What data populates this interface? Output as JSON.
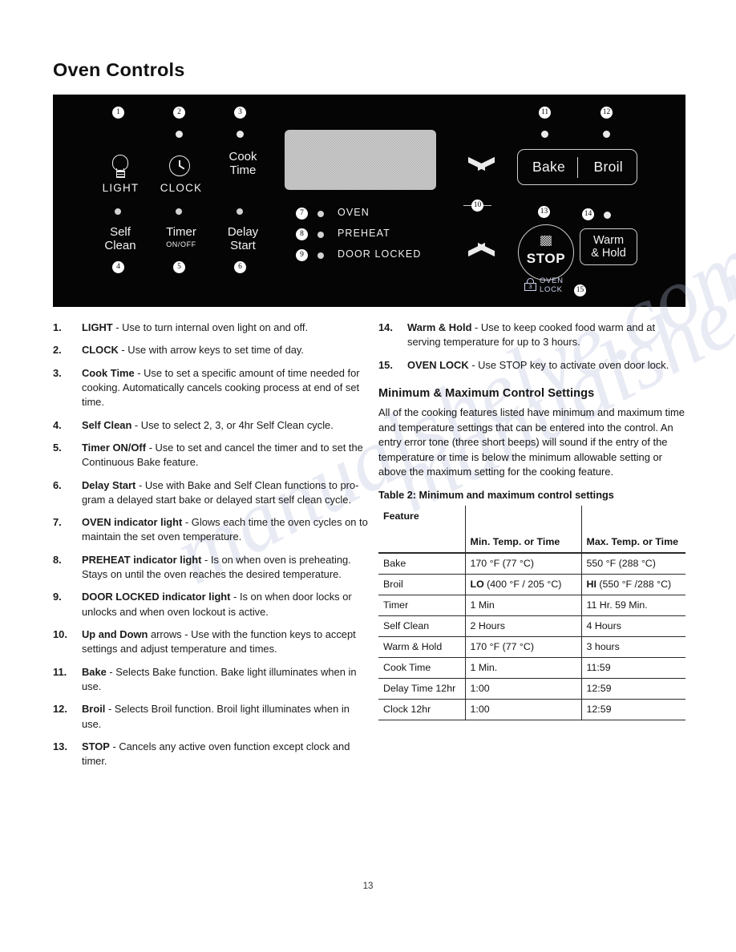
{
  "page": {
    "title": "Oven Controls",
    "page_number": "13",
    "watermark": "manualshelve.com"
  },
  "panel": {
    "display_label": "display-window",
    "keys": [
      {
        "callout": "1",
        "label": "LIGHT",
        "icon": "light-bulb-icon"
      },
      {
        "callout": "2",
        "label": "CLOCK",
        "icon": "clock-icon"
      },
      {
        "callout": "3",
        "label_line1": "Cook",
        "label_line2": "Time"
      },
      {
        "callout": "4",
        "label_line1": "Self",
        "label_line2": "Clean"
      },
      {
        "callout": "5",
        "label_line1": "Timer",
        "sub": "ON/OFF"
      },
      {
        "callout": "6",
        "label_line1": "Delay",
        "label_line2": "Start"
      }
    ],
    "indicators": [
      {
        "callout": "7",
        "label": "OVEN"
      },
      {
        "callout": "8",
        "label": "PREHEAT"
      },
      {
        "callout": "9",
        "label": "DOOR LOCKED"
      }
    ],
    "arrows": {
      "callout": "10",
      "up": "up-arrow",
      "down": "down-arrow"
    },
    "bake_broil": {
      "bake_callout": "11",
      "broil_callout": "12",
      "bake_label": "Bake",
      "broil_label": "Broil"
    },
    "stop": {
      "callout": "13",
      "label": "STOP"
    },
    "warm_hold": {
      "callout": "14",
      "line1": "Warm",
      "line2": "& Hold"
    },
    "oven_lock": {
      "callout": "15",
      "line1": "OVEN",
      "line2": "LOCK",
      "lock_digit": "3"
    }
  },
  "left_list": [
    {
      "num": "1.",
      "term": "LIGHT",
      "rest": " - Use to turn internal oven light on and off."
    },
    {
      "num": "2.",
      "term": "CLOCK",
      "rest": " - Use with arrow keys to set time of day."
    },
    {
      "num": "3.",
      "term": "Cook Time",
      "rest": " - Use to set a specific amount of time needed for cooking. Automatically cancels cooking process at end of set time."
    },
    {
      "num": "4.",
      "term": "Self Clean",
      "rest": " - Use to select 2, 3, or 4hr Self Clean cycle."
    },
    {
      "num": "5.",
      "term": "Timer ON/Off",
      "rest": " - Use to set and cancel the timer and to set the Continuous Bake feature."
    },
    {
      "num": "6.",
      "term": "Delay Start",
      "rest": " - Use with Bake and Self Clean functions to pro-gram a delayed start bake or delayed start self clean cycle."
    },
    {
      "num": "7.",
      "term": "OVEN indicator light",
      "rest": " - Glows each time the oven cycles on to maintain the set oven temperature."
    },
    {
      "num": "8.",
      "term": "PREHEAT indicator light",
      "rest": " - Is on when oven is preheating. Stays on until the oven reaches the desired temperature."
    },
    {
      "num": "9.",
      "term": "DOOR LOCKED indicator light",
      "rest": " - Is on when door locks or unlocks and when oven lockout is active."
    },
    {
      "num": "10.",
      "term": "Up and Down",
      "rest": " arrows - Use with the function keys to accept settings and adjust temperature and times."
    },
    {
      "num": "11.",
      "term": "Bake",
      "rest": " - Selects Bake function. Bake light illuminates when in use."
    },
    {
      "num": "12.",
      "term": "Broil",
      "rest": " - Selects Broil function. Broil light illuminates when in use."
    },
    {
      "num": "13.",
      "term": "STOP",
      "rest": " - Cancels any active oven function except clock and timer."
    }
  ],
  "right_list": [
    {
      "num": "14.",
      "term": "Warm & Hold",
      "rest": " - Use to keep cooked food warm and at serving temperature for up to 3 hours."
    },
    {
      "num": "15.",
      "term": "OVEN LOCK",
      "rest": " - Use STOP key to activate oven door lock."
    }
  ],
  "right_section": {
    "heading": "Minimum & Maximum Control Settings",
    "paragraph": "All of the cooking features listed have minimum and maximum time and temperature settings that can be entered into the control. An entry error tone (three short beeps) will sound if the entry of the temperature or time is below the minimum allowable setting or above the maximum setting for the cooking feature.",
    "table_caption_prefix": "Table 2:",
    "table_caption": "Minimum and maximum control settings"
  },
  "table": {
    "headers": [
      "Feature",
      "Min. Temp. or Time",
      "Max. Temp. or Time"
    ],
    "rows": [
      {
        "feature": "Bake",
        "min": "170 °F (77 °C)",
        "max": "550 °F (288 °C)",
        "min_bold": "",
        "max_bold": ""
      },
      {
        "feature": "Broil",
        "min": " (400 °F / 205 °C)",
        "max": " (550 °F /288 °C)",
        "min_bold": "LO",
        "max_bold": "HI"
      },
      {
        "feature": "Timer",
        "min": "1 Min",
        "max": "11 Hr. 59 Min.",
        "min_bold": "",
        "max_bold": ""
      },
      {
        "feature": "Self Clean",
        "min": "2 Hours",
        "max": "4 Hours",
        "min_bold": "",
        "max_bold": ""
      },
      {
        "feature": "Warm & Hold",
        "min": "170 °F (77 °C)",
        "max": "3 hours",
        "min_bold": "",
        "max_bold": ""
      },
      {
        "feature": "Cook Time",
        "min": "1 Min.",
        "max": "11:59",
        "min_bold": "",
        "max_bold": ""
      },
      {
        "feature": "Delay Time 12hr",
        "min": "1:00",
        "max": "12:59",
        "min_bold": "",
        "max_bold": ""
      },
      {
        "feature": "Clock 12hr",
        "min": "1:00",
        "max": "12:59",
        "min_bold": "",
        "max_bold": ""
      }
    ]
  }
}
